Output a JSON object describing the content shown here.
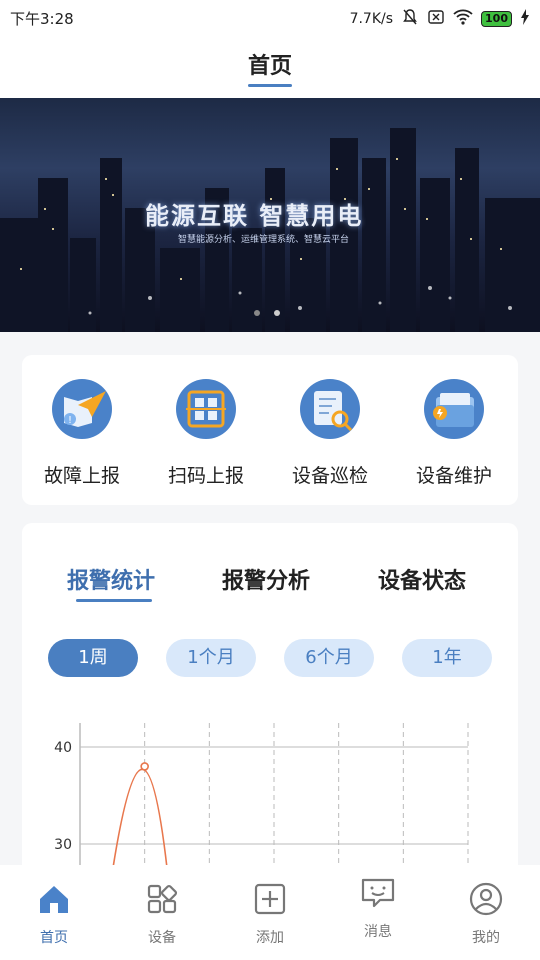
{
  "status_bar": {
    "time": "下午3:28",
    "network_speed": "7.7K/s",
    "battery": "100"
  },
  "header": {
    "title": "首页"
  },
  "banner": {
    "slogan": "能源互联  智慧用电",
    "subtitle": "智慧能源分析、运维管理系统、智慧云平台",
    "slide_count": 2,
    "active_slide": 2
  },
  "quick_actions": [
    {
      "label": "故障上报",
      "icon": "fault-report-icon"
    },
    {
      "label": "扫码上报",
      "icon": "scan-code-icon"
    },
    {
      "label": "设备巡检",
      "icon": "device-inspection-icon"
    },
    {
      "label": "设备维护",
      "icon": "device-maintenance-icon"
    }
  ],
  "stats_tabs": [
    {
      "label": "报警统计",
      "active": true
    },
    {
      "label": "报警分析",
      "active": false
    },
    {
      "label": "设备状态",
      "active": false
    }
  ],
  "period_filters": [
    {
      "label": "1周",
      "active": true
    },
    {
      "label": "1个月",
      "active": false
    },
    {
      "label": "6个月",
      "active": false
    },
    {
      "label": "1年",
      "active": false
    }
  ],
  "chart_data": {
    "type": "line",
    "y_ticks": [
      40,
      30
    ],
    "ylim": [
      20,
      40
    ],
    "x_points": 7,
    "series": [
      {
        "values": [
          null,
          38,
          null,
          null,
          null,
          null,
          null
        ],
        "color": "#e8774d"
      }
    ],
    "grid": true
  },
  "tab_bar": [
    {
      "label": "首页",
      "icon": "home-icon",
      "active": true
    },
    {
      "label": "设备",
      "icon": "device-grid-icon",
      "active": false
    },
    {
      "label": "添加",
      "icon": "add-icon",
      "active": false
    },
    {
      "label": "消息",
      "icon": "message-icon",
      "active": false
    },
    {
      "label": "我的",
      "icon": "profile-icon",
      "active": false
    }
  ],
  "colors": {
    "accent": "#4a7fc1",
    "accent_light": "#d9e8fa",
    "chart_line": "#e8774d"
  }
}
